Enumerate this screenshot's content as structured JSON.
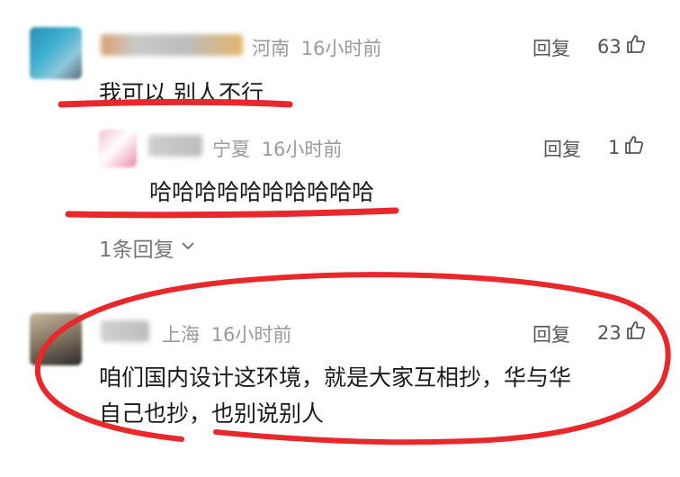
{
  "comments": [
    {
      "location": "河南",
      "time": "16小时前",
      "text": "我可以 别人不行",
      "reply_label": "回复",
      "likes": "63",
      "replies": [
        {
          "location": "宁夏",
          "time": "16小时前",
          "text": "哈哈哈哈哈哈哈哈哈哈",
          "reply_label": "回复",
          "likes": "1"
        }
      ],
      "expand_label": "1条回复"
    },
    {
      "location": "上海",
      "time": "16小时前",
      "text_line1": "咱们国内设计这环境，就是大家互相抄，华与华",
      "text_line2": "自己也抄，也别说别人",
      "reply_label": "回复",
      "likes": "23"
    }
  ],
  "colors": {
    "annotation_red": "#e8282b",
    "meta_gray": "#9a9a9a"
  },
  "icons": [
    "thumbs-up-icon",
    "chevron-down-icon"
  ]
}
